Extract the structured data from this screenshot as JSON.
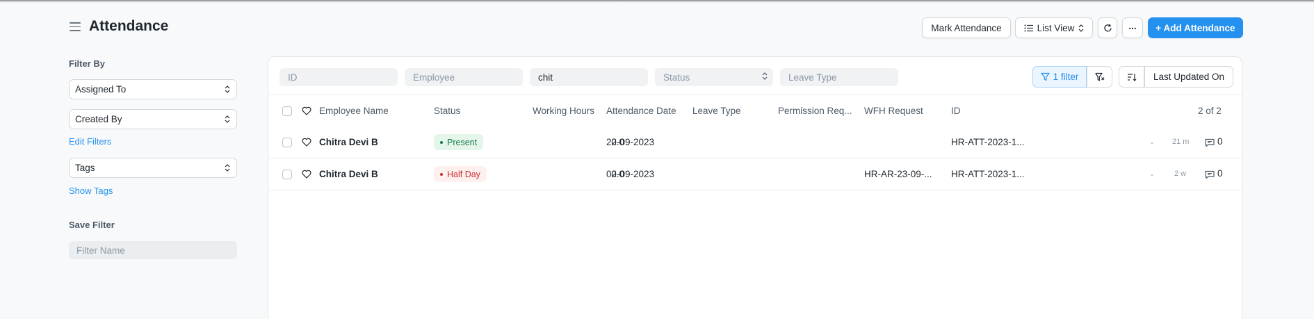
{
  "page": {
    "title": "Attendance",
    "buttons": {
      "mark_attendance": "Mark Attendance",
      "list_view": "List View",
      "more": "...",
      "add_attendance": "+ Add Attendance"
    }
  },
  "sidebar": {
    "filter_by_label": "Filter By",
    "assigned_to": "Assigned To",
    "created_by": "Created By",
    "edit_filters": "Edit Filters",
    "tags": "Tags",
    "show_tags": "Show Tags",
    "save_filter_label": "Save Filter",
    "filter_name_placeholder": "Filter Name"
  },
  "filters": {
    "id_placeholder": "ID",
    "employee_placeholder": "Employee",
    "employee_name_value": "chit",
    "status_placeholder": "Status",
    "leave_type_placeholder": "Leave Type",
    "active_filter_label": "1 filter",
    "sort_label": "Last Updated On"
  },
  "table": {
    "columns": [
      "Employee Name",
      "Status",
      "Working Hours",
      "Attendance Date",
      "Leave Type",
      "Permission Req...",
      "WFH Request",
      "ID"
    ],
    "count": "2 of 2",
    "rows": [
      {
        "employee_name": "Chitra Devi B",
        "status": "Present",
        "working_hours": "0.0",
        "attendance_date": "22-09-2023",
        "leave_type": "",
        "permission_request": "",
        "wfh_request": "",
        "id": "HR-ATT-2023-1...",
        "assigned": "-",
        "modified": "21 m",
        "comments": "0"
      },
      {
        "employee_name": "Chitra Devi B",
        "status": "Half Day",
        "working_hours": "0.0",
        "attendance_date": "02-09-2023",
        "leave_type": "",
        "permission_request": "",
        "wfh_request": "HR-AR-23-09-...",
        "id": "HR-ATT-2023-1...",
        "assigned": "-",
        "modified": "2 w",
        "comments": "0"
      }
    ]
  },
  "colors": {
    "primary": "#2490ef",
    "present_bg": "#e4f5e9",
    "present_text": "#16794c",
    "half_day_bg": "#fff0f0",
    "half_day_text": "#c4302b"
  }
}
